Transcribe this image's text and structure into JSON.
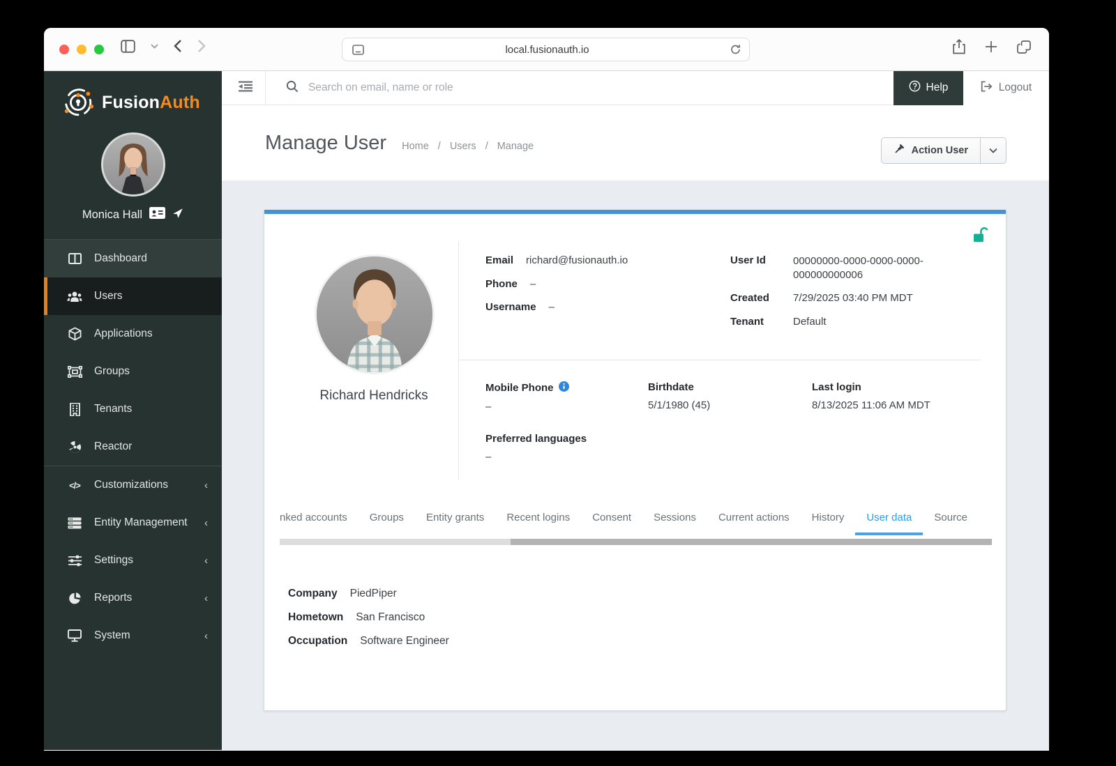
{
  "browser": {
    "url": "local.fusionauth.io"
  },
  "colors": {
    "brand_orange": "#f58a1f",
    "card_accent_blue": "#4493d9",
    "active_tab_blue": "#2d9bed",
    "lock_green": "#14b094",
    "sidebar_bg": "#273330",
    "active_item_orange": "#e5801c"
  },
  "sidebar": {
    "brand": {
      "first": "Fusion",
      "second": "Auth"
    },
    "account": {
      "name": "Monica Hall"
    },
    "items": [
      {
        "label": "Dashboard"
      },
      {
        "label": "Users"
      },
      {
        "label": "Applications"
      },
      {
        "label": "Groups"
      },
      {
        "label": "Tenants"
      },
      {
        "label": "Reactor"
      }
    ],
    "groups": [
      {
        "label": "Customizations"
      },
      {
        "label": "Entity Management"
      },
      {
        "label": "Settings"
      },
      {
        "label": "Reports"
      },
      {
        "label": "System"
      }
    ],
    "chevron": "‹",
    "code_glyph": "</>"
  },
  "topbar": {
    "search_placeholder": "Search on email, name or role",
    "help": "Help",
    "logout": "Logout"
  },
  "page": {
    "title": "Manage User",
    "breadcrumbs": [
      "Home",
      "Users",
      "Manage"
    ],
    "sep1": "/",
    "sep2": "/",
    "action_button": "Action User"
  },
  "card": {
    "name": "Richard Hendricks",
    "identity": [
      {
        "label": "Email",
        "value": "richard@fusionauth.io"
      },
      {
        "label": "Phone",
        "value": "–"
      },
      {
        "label": "Username",
        "value": "–"
      }
    ],
    "meta": [
      {
        "label": "User Id",
        "value": "00000000-0000-0000-0000-000000000006"
      },
      {
        "label": "Created",
        "value": "7/29/2025 03:40 PM MDT"
      },
      {
        "label": "Tenant",
        "value": "Default"
      }
    ],
    "extra": [
      {
        "label": "Mobile Phone",
        "value": "–"
      },
      {
        "label": "Birthdate",
        "value": "5/1/1980 (45)"
      },
      {
        "label": "Last login",
        "value": "8/13/2025 11:06 AM MDT"
      },
      {
        "label": "Preferred languages",
        "value": "–"
      }
    ]
  },
  "tabs": [
    "nked accounts",
    "Groups",
    "Entity grants",
    "Recent logins",
    "Consent",
    "Sessions",
    "Current actions",
    "History",
    "User data",
    "Source"
  ],
  "active_tab": "User data",
  "user_data": [
    {
      "label": "Company",
      "value": "PiedPiper"
    },
    {
      "label": "Hometown",
      "value": "San Francisco"
    },
    {
      "label": "Occupation",
      "value": "Software Engineer"
    }
  ]
}
